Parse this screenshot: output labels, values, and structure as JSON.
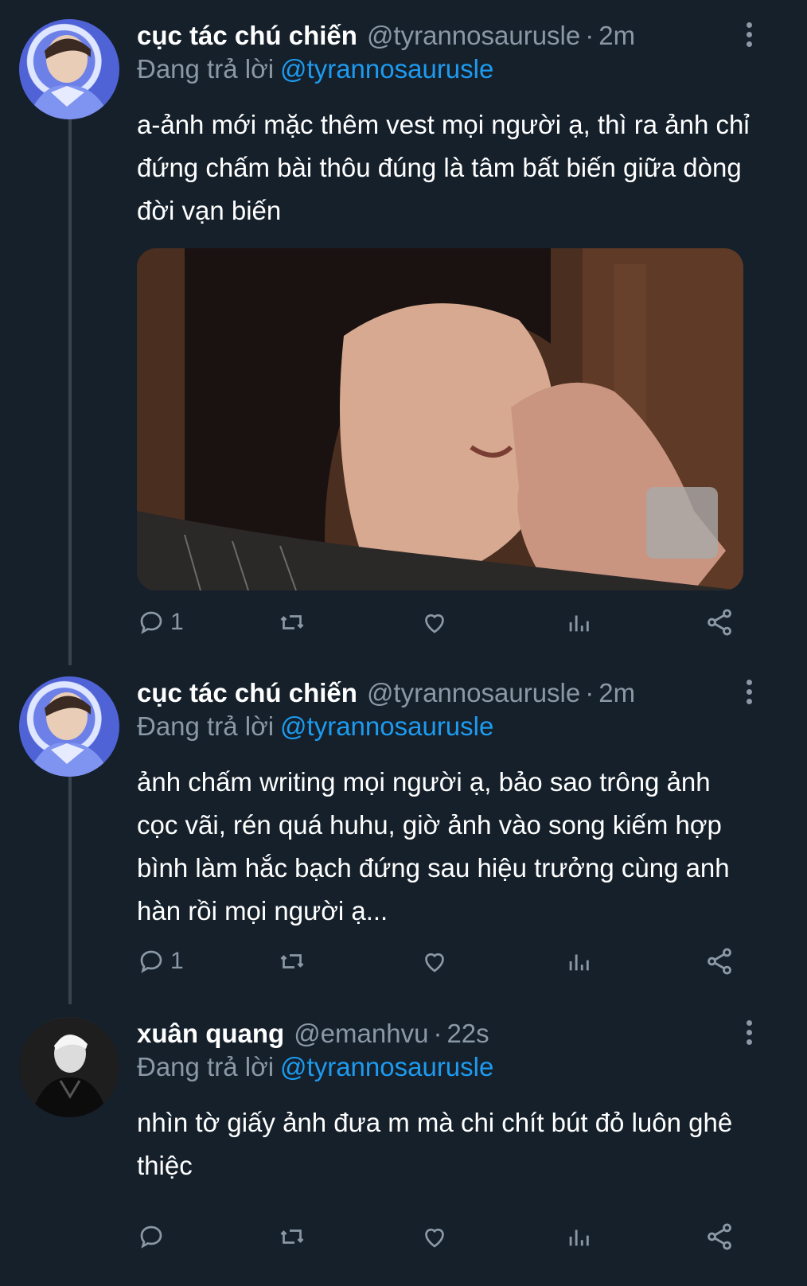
{
  "tweets": [
    {
      "display_name": "cục tác chú chiến",
      "handle": "@tyrannosaurusle",
      "separator": "·",
      "time": "2m",
      "replying_label": "Đang trả lời",
      "replying_to": "@tyrannosaurusle",
      "text": "a-ảnh mới mặc thêm vest mọi người ạ, thì ra ảnh chỉ đứng chấm bài thôu đúng là tâm bất biến giữa dòng đời vạn biến",
      "has_media": true,
      "reply_count": "1",
      "avatar_icon": "user-avatar-blue"
    },
    {
      "display_name": "cục tác chú chiến",
      "handle": "@tyrannosaurusle",
      "separator": "·",
      "time": "2m",
      "replying_label": "Đang trả lời",
      "replying_to": "@tyrannosaurusle",
      "text": "ảnh chấm writing mọi người ạ, bảo sao trông ảnh cọc vãi, rén quá huhu, giờ ảnh vào song kiếm hợp bình làm hắc bạch đứng sau hiệu trưởng cùng anh hàn rồi mọi người ạ...",
      "has_media": false,
      "reply_count": "1",
      "avatar_icon": "user-avatar-blue"
    },
    {
      "display_name": "xuân quang",
      "handle": "@emanhvu",
      "separator": "·",
      "time": "22s",
      "replying_label": "Đang trả lời",
      "replying_to": "@tyrannosaurusle",
      "text": "nhìn tờ giấy ảnh đưa m mà chi chít bút đỏ luôn ghê thiệc",
      "has_media": false,
      "reply_count": "",
      "avatar_icon": "user-avatar-mono"
    }
  ],
  "icons": {
    "reply": "reply-icon",
    "retweet": "retweet-icon",
    "like": "like-icon",
    "analytics": "analytics-icon",
    "share": "share-icon",
    "more": "more-options-icon"
  },
  "colors": {
    "background": "#15202b",
    "secondary_text": "#8b98a5",
    "mention": "#1d9bf0",
    "thread_line": "#38444d"
  }
}
